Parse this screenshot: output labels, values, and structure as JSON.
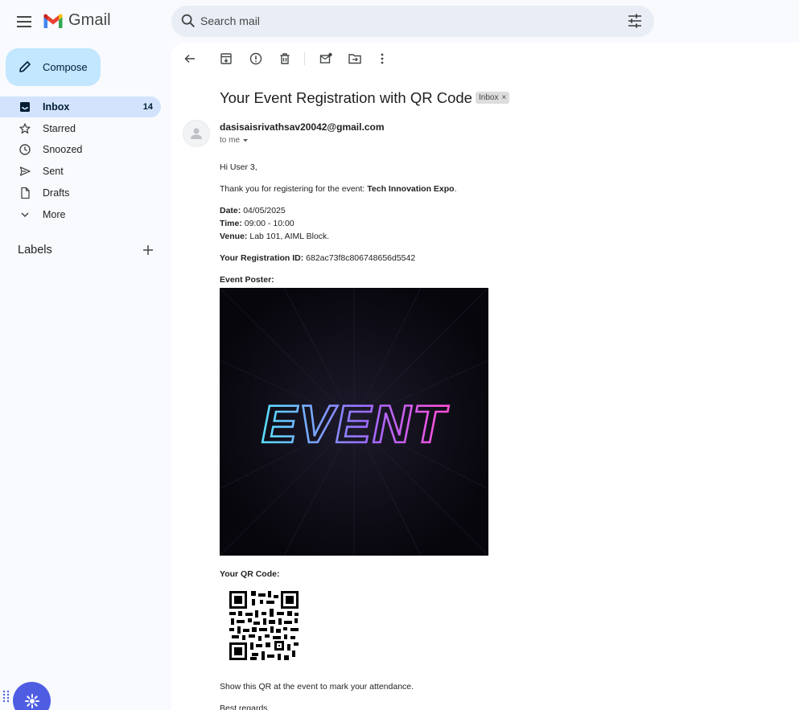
{
  "app": {
    "name": "Gmail"
  },
  "search": {
    "placeholder": "Search mail"
  },
  "sidebar": {
    "compose_label": "Compose",
    "items": [
      {
        "label": "Inbox",
        "count": "14"
      },
      {
        "label": "Starred"
      },
      {
        "label": "Snoozed"
      },
      {
        "label": "Sent"
      },
      {
        "label": "Drafts"
      },
      {
        "label": "More"
      }
    ],
    "labels_header": "Labels"
  },
  "email": {
    "subject": "Your Event Registration with QR Code",
    "chip": "Inbox",
    "sender": "dasisaisrivathsav20042@gmail.com",
    "recipient": "to me",
    "greeting": "Hi User 3,",
    "thanks_prefix": "Thank you for registering for the event: ",
    "event_name": "Tech Innovation Expo",
    "date_label": "Date:",
    "date": "04/05/2025",
    "time_label": "Time:",
    "time": "09:00 - 10:00",
    "venue_label": "Venue:",
    "venue": "Lab 101, AIML Block.",
    "regid_label": "Your Registration ID:",
    "regid": "682ac73f8c806748656d5542",
    "poster_label": "Event Poster:",
    "poster_word": "EVENT",
    "qr_label": "Your QR Code:",
    "show_qr": "Show this QR at the event to mark your attendance.",
    "signoff": "Best regards,"
  },
  "colors": {
    "accent": "#c2e7ff",
    "active_nav": "#d3e3fd",
    "assistant": "#4f5de3"
  }
}
